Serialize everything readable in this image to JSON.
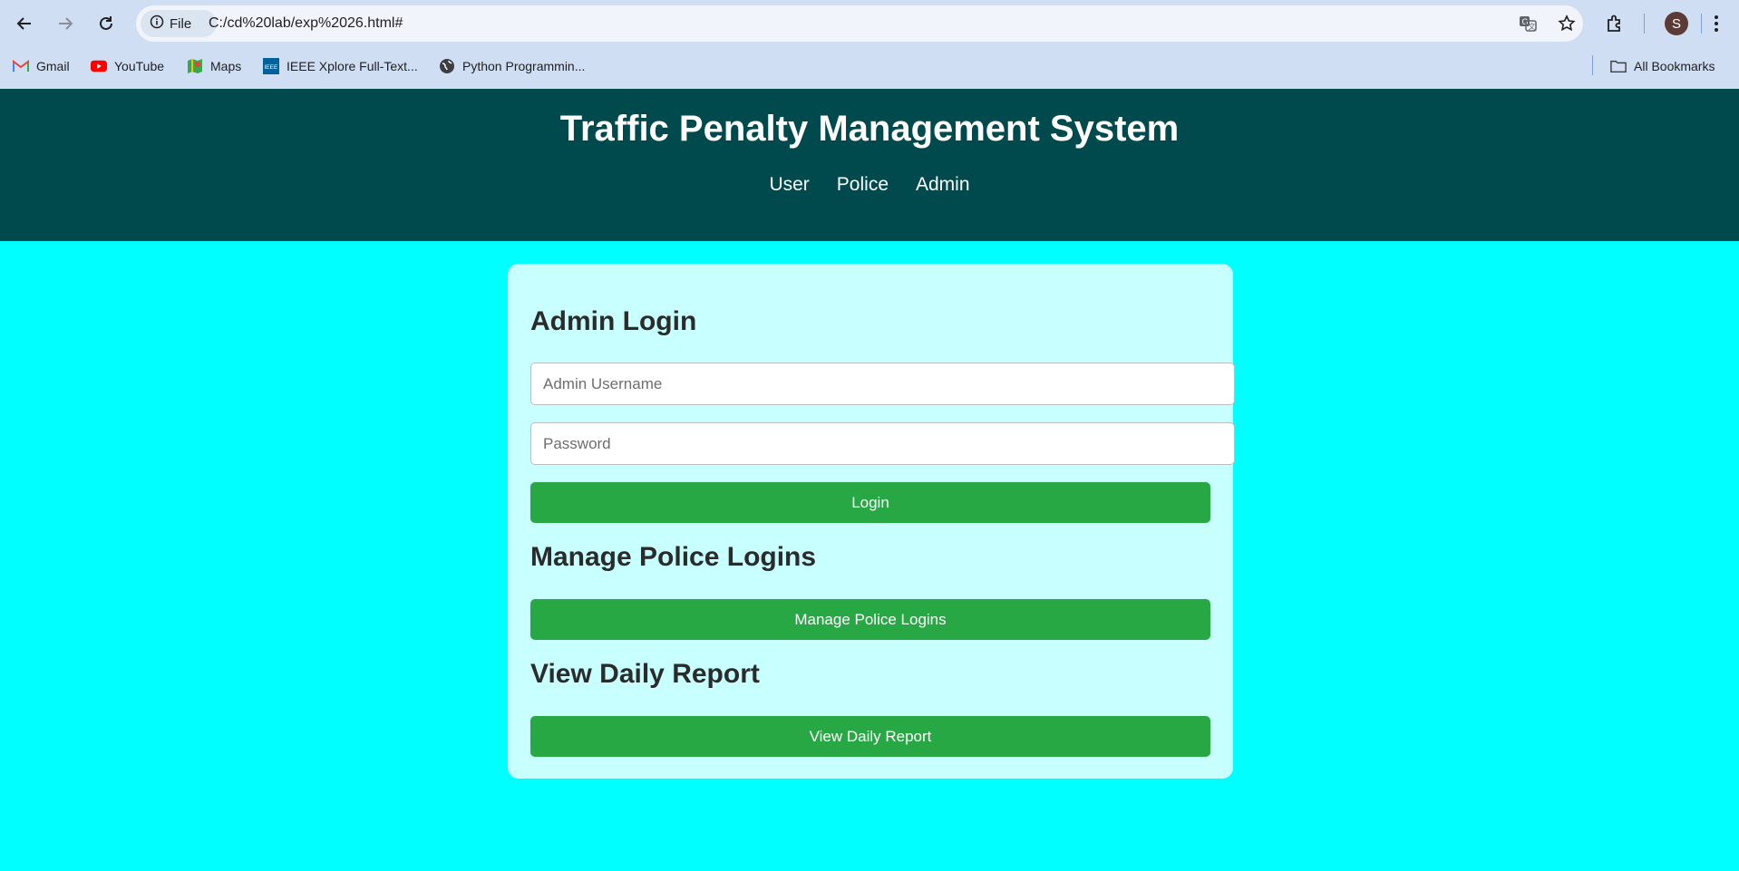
{
  "browser": {
    "site_chip": "File",
    "url": "C:/cd%20lab/exp%2026.html#",
    "profile_initial": "S",
    "icons": [
      "back-icon",
      "forward-icon",
      "reload-icon",
      "info-icon",
      "translate-icon",
      "star-icon",
      "extensions-icon",
      "menu-icon"
    ],
    "bookmarks": [
      {
        "label": "Gmail",
        "icon": "gmail-icon"
      },
      {
        "label": "YouTube",
        "icon": "youtube-icon"
      },
      {
        "label": "Maps",
        "icon": "maps-icon"
      },
      {
        "label": "IEEE Xplore Full-Text...",
        "icon": "ieee-icon"
      },
      {
        "label": "Python Programmin...",
        "icon": "globe-icon"
      }
    ],
    "all_bookmarks": "All Bookmarks"
  },
  "header": {
    "title": "Traffic Penalty Management System",
    "nav": [
      "User",
      "Police",
      "Admin"
    ]
  },
  "admin": {
    "login_heading": "Admin Login",
    "username_placeholder": "Admin Username",
    "password_placeholder": "Password",
    "login_button": "Login",
    "manage_heading": "Manage Police Logins",
    "manage_button": "Manage Police Logins",
    "report_heading": "View Daily Report",
    "report_button": "View Daily Report"
  },
  "colors": {
    "page_background": "#00ffff",
    "header_background": "#004a4d",
    "card_background": "#c8ffff",
    "button_green": "#28a745"
  }
}
